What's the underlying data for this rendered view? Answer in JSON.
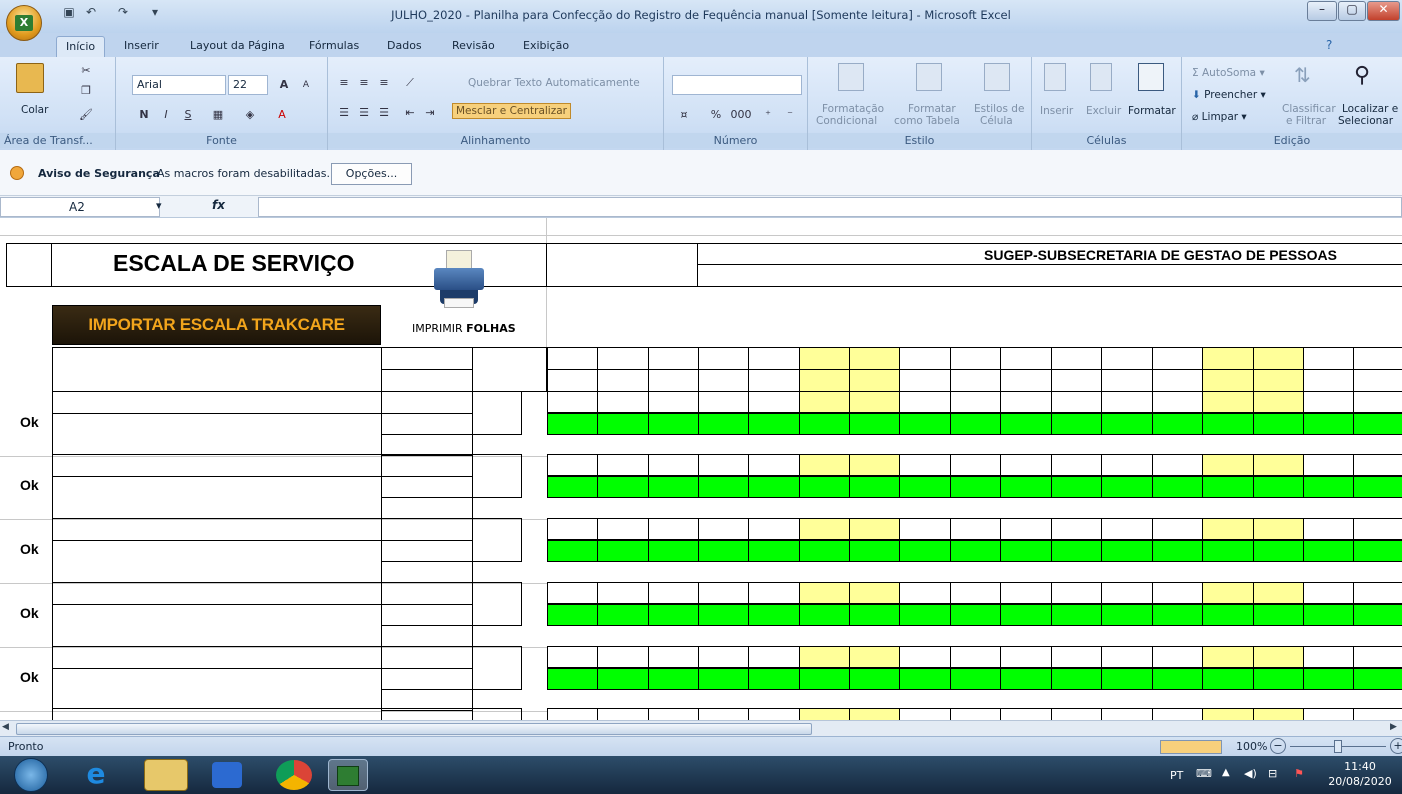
{
  "window": {
    "title": "JULHO_2020 - Planilha para Confecção do Registro de Fequência manual  [Somente leitura] - Microsoft Excel"
  },
  "tabs": [
    "Início",
    "Inserir",
    "Layout da Página",
    "Fórmulas",
    "Dados",
    "Revisão",
    "Exibição"
  ],
  "ribbon": {
    "clipboard": {
      "paste": "Colar",
      "label": "Área de Transf..."
    },
    "font": {
      "name": "Arial",
      "size": "22",
      "label": "Fonte",
      "bold": "N",
      "italic": "I",
      "underline": "S"
    },
    "alignment": {
      "wrap": "Quebrar Texto Automaticamente",
      "merge": "Mesclar e Centralizar",
      "label": "Alinhamento"
    },
    "number": {
      "label": "Número",
      "percent": "%",
      "thousands": "000"
    },
    "styles": {
      "conditional_1": "Formatação",
      "conditional_2": "Condicional",
      "table_1": "Formatar",
      "table_2": "como Tabela",
      "cell_1": "Estilos de",
      "cell_2": "Célula",
      "label": "Estilo"
    },
    "cells": {
      "insert": "Inserir",
      "delete": "Excluir",
      "format": "Formatar",
      "label": "Células"
    },
    "editing": {
      "autosum": "AutoSoma",
      "fill": "Preencher",
      "clear": "Limpar",
      "sort_1": "Classificar",
      "sort_2": "e Filtrar",
      "find_1": "Localizar e",
      "find_2": "Selecionar",
      "label": "Edição"
    }
  },
  "security": {
    "title": "Aviso de Segurança",
    "message": "As macros foram desabilitadas.",
    "button": "Opções..."
  },
  "formula_bar": {
    "name_box": "A2",
    "fx": "fx",
    "value": ""
  },
  "sheet": {
    "heading": "ESCALA DE SERVIÇO",
    "org": "SUGEP-SUBSECRETARIA DE GESTAO DE PESSOAS",
    "import_button": "IMPORTAR ESCALA TRAKCARE",
    "print_label_1": "IMPRIMIR ",
    "print_label_2": "FOLHAS",
    "row_status": [
      "Ok",
      "Ok",
      "Ok",
      "Ok",
      "Ok"
    ],
    "colors": {
      "green": "#00ff00",
      "yellow": "#ffff99"
    }
  },
  "statusbar": {
    "ready": "Pronto",
    "zoom": "100%"
  },
  "taskbar": {
    "lang": "PT",
    "time": "11:40",
    "date": "20/08/2020"
  }
}
